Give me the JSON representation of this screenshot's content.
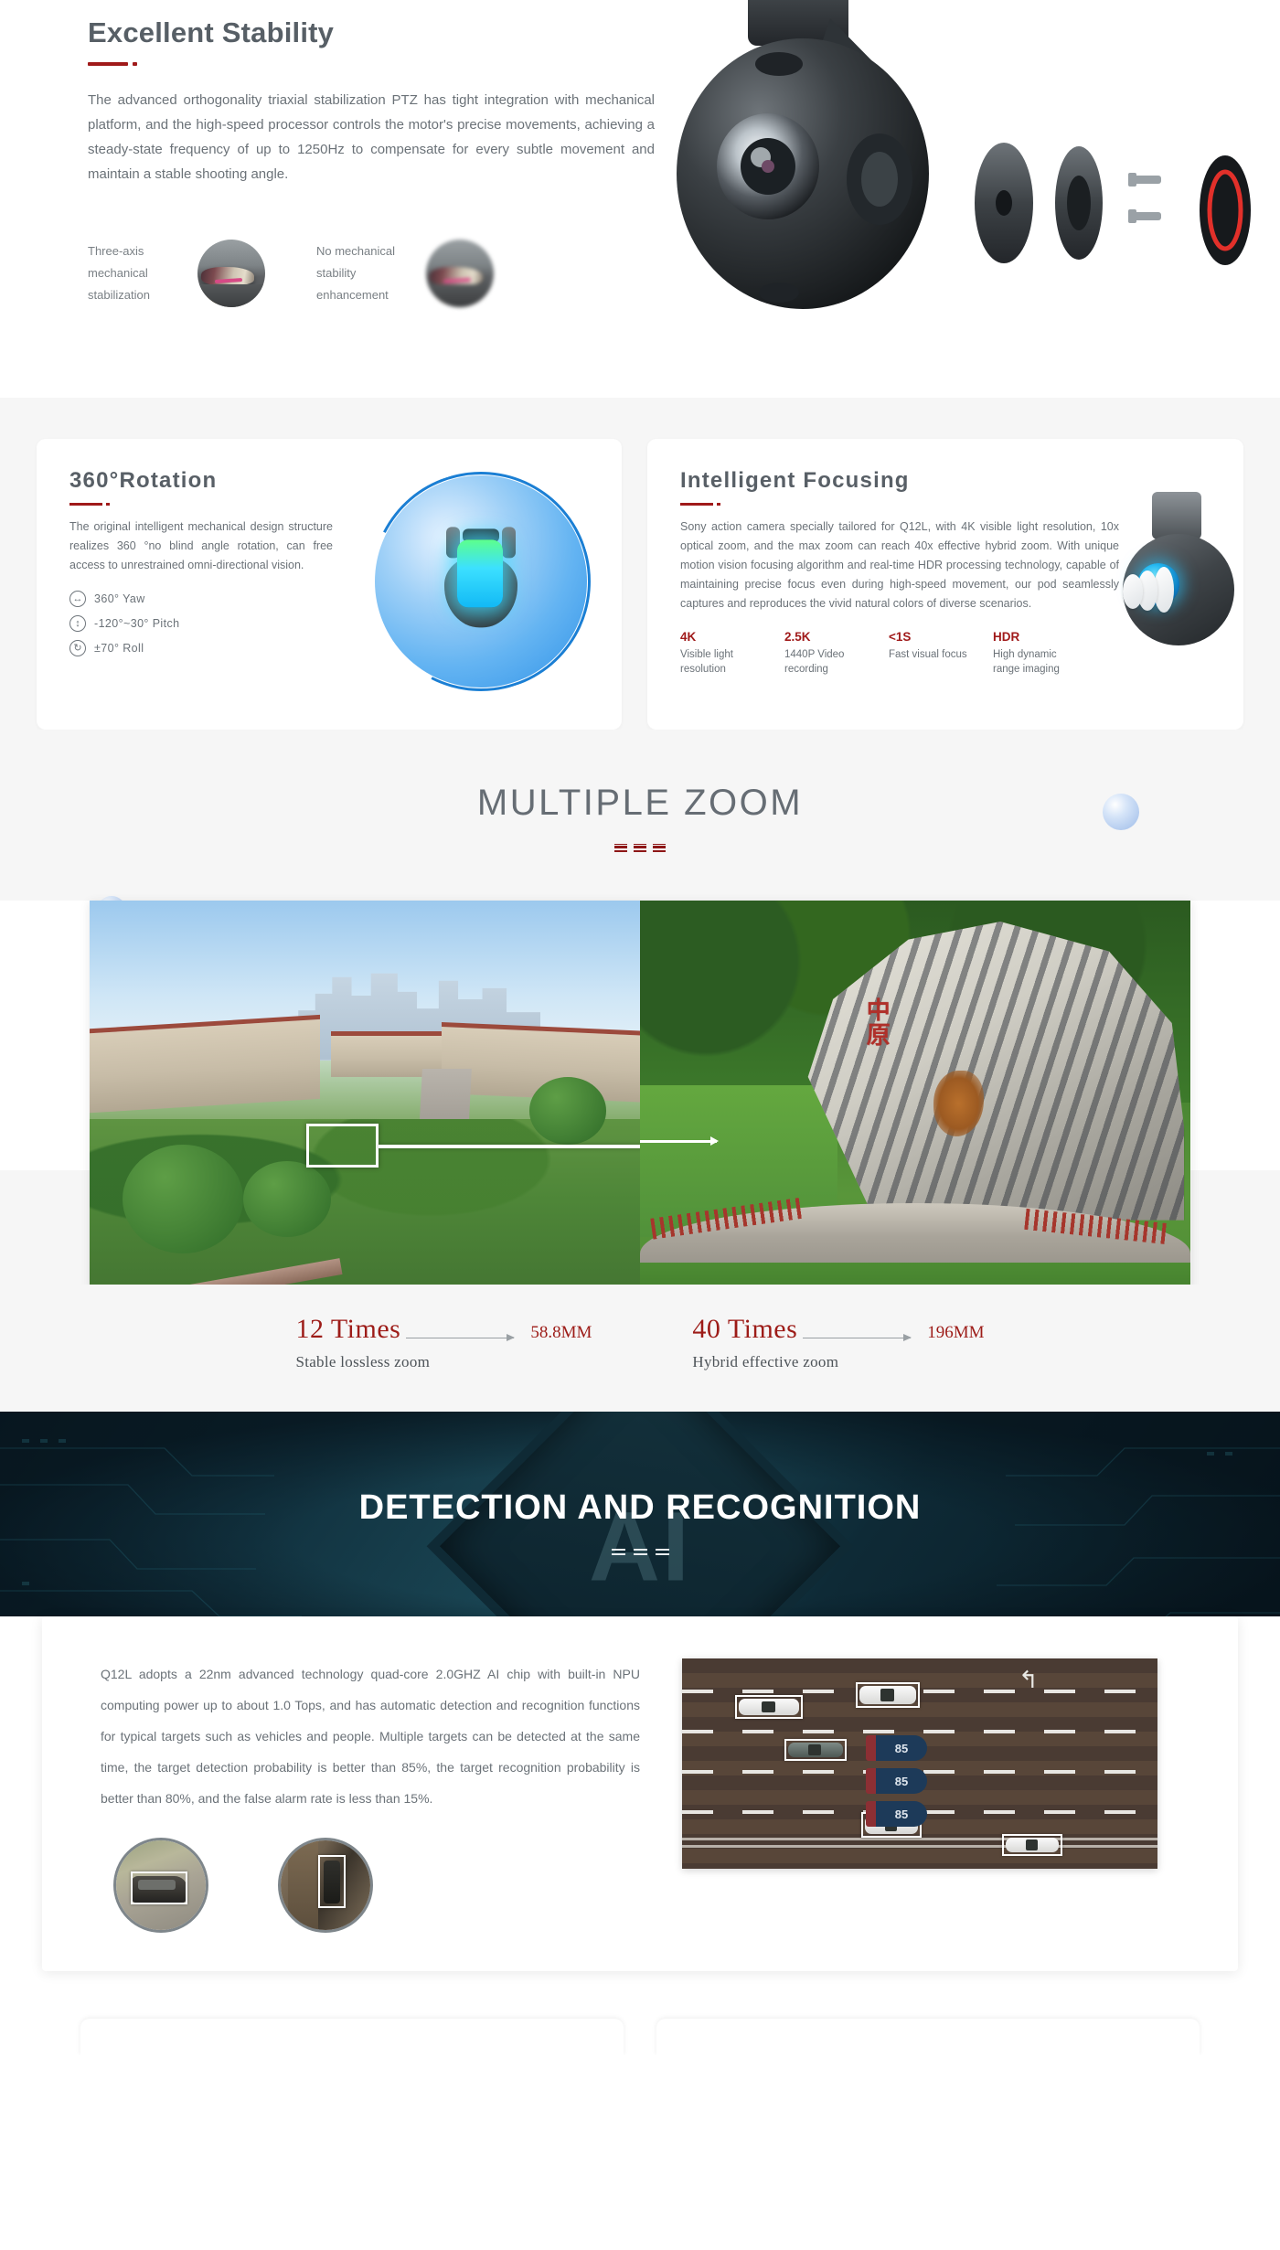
{
  "stability": {
    "title": "Excellent Stability",
    "paragraph": "The advanced orthogonality triaxial stabilization PTZ has tight integration with mechanical platform, and the high-speed processor controls the motor's precise movements, achieving a steady-state frequency of up to 1250Hz to compensate for every subtle movement and maintain a stable shooting angle.",
    "thumbs": [
      {
        "label": "Three-axis mechanical stabilization"
      },
      {
        "label": "No mechanical stability enhancement"
      }
    ]
  },
  "rotation": {
    "title": "360°Rotation",
    "paragraph": "The original intelligent mechanical design structure realizes 360 °no blind angle rotation, can free access to unrestrained omni-directional vision.",
    "specs": [
      {
        "icon": "yaw-arrows-icon",
        "glyph": "↔",
        "text": "360°  Yaw"
      },
      {
        "icon": "pitch-arrows-icon",
        "glyph": "↕",
        "text": "-120°~30° Pitch"
      },
      {
        "icon": "roll-arrows-icon",
        "glyph": "↻",
        "text": "±70° Roll"
      }
    ]
  },
  "focusing": {
    "title": "Intelligent Focusing",
    "paragraph": "Sony action camera specially tailored for Q12L, with 4K visible light resolution, 10x optical zoom, and the max zoom can reach 40x effective hybrid zoom. With unique motion vision focusing algorithm and real-time HDR processing technology, capable of maintaining precise focus even during high-speed movement, our pod seamlessly captures and reproduces the vivid natural colors of diverse scenarios.",
    "metrics": [
      {
        "key": "4K",
        "value": "Visible light resolution"
      },
      {
        "key": "2.5K",
        "value": "1440P  Video recording"
      },
      {
        "key": "<1S",
        "value": "Fast visual focus"
      },
      {
        "key": "HDR",
        "value": "High dynamic range imaging"
      }
    ]
  },
  "zoom_section": {
    "heading": "MULTIPLE ZOOM",
    "photo_left_alt": "wide-angle-aerial-campus-view",
    "photo_right_alt": "zoomed-engraved-rock-view",
    "stats": [
      {
        "times": "12 Times",
        "mm": "58.8MM",
        "sub": "Stable  lossless  zoom"
      },
      {
        "times": "40 Times",
        "mm": "196MM",
        "sub": "Hybrid effective zoom"
      }
    ]
  },
  "detection": {
    "banner_title": "DETECTION AND RECOGNITION",
    "chip_label": "AI",
    "chip_tops": "1.0 TOPS",
    "paragraph": "Q12L adopts a 22nm advanced technology quad-core 2.0GHZ AI chip with built-in NPU computing power up to about 1.0 Tops, and has automatic detection and recognition functions for typical targets such as vehicles and people. Multiple targets can be detected at the same time, the target detection probability is better than 85%, the target recognition probability is better than 80%, and the false alarm rate is less than 15%.",
    "thumbs": [
      {
        "alt": "vehicle-detection-thumbnail"
      },
      {
        "alt": "person-detection-thumbnail"
      }
    ],
    "road_alt": "aerial-highway-vehicle-detection",
    "road_markers": [
      "85",
      "85",
      "85"
    ]
  },
  "bottom_cards": [
    {
      "text": ""
    },
    {
      "text": ""
    }
  ],
  "colors": {
    "accent_red": "#a01a1a",
    "heading_gray": "#575f66",
    "body_gray": "#6b7278",
    "section_bg": "#f6f6f6",
    "banner_dark": "#0b2430",
    "sphere_blue": "#2f92e8"
  }
}
